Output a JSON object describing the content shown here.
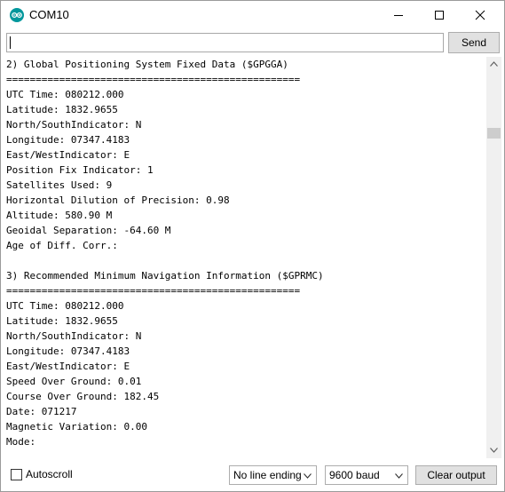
{
  "window": {
    "title": "COM10"
  },
  "toolbar": {
    "input_value": "",
    "send_label": "Send"
  },
  "output": {
    "lines": [
      "2) Global Positioning System Fixed Data ($GPGGA)",
      "==================================================",
      "UTC Time: 080212.000",
      "Latitude: 1832.9655",
      "North/SouthIndicator: N",
      "Longitude: 07347.4183",
      "East/WestIndicator: E",
      "Position Fix Indicator: 1",
      "Satellites Used: 9",
      "Horizontal Dilution of Precision: 0.98",
      "Altitude: 580.90 M",
      "Geoidal Separation: -64.60 M",
      "Age of Diff. Corr.:",
      "",
      "3) Recommended Minimum Navigation Information ($GPRMC)",
      "==================================================",
      "UTC Time: 080212.000",
      "Latitude: 1832.9655",
      "North/SouthIndicator: N",
      "Longitude: 07347.4183",
      "East/WestIndicator: E",
      "Speed Over Ground: 0.01",
      "Course Over Ground: 182.45",
      "Date: 071217",
      "Magnetic Variation: 0.00",
      "Mode:"
    ]
  },
  "footer": {
    "autoscroll_label": "Autoscroll",
    "autoscroll_checked": false,
    "line_ending": "No line ending",
    "baud_rate": "9600 baud",
    "clear_label": "Clear output"
  },
  "colors": {
    "icon_teal": "#00979c",
    "button_bg": "#e1e1e1",
    "border": "#adadad"
  },
  "icons": [
    "arduino-logo-icon",
    "minimize-icon",
    "maximize-icon",
    "close-icon",
    "scroll-up-icon",
    "scroll-down-icon",
    "chevron-down-icon",
    "checkbox-icon"
  ]
}
